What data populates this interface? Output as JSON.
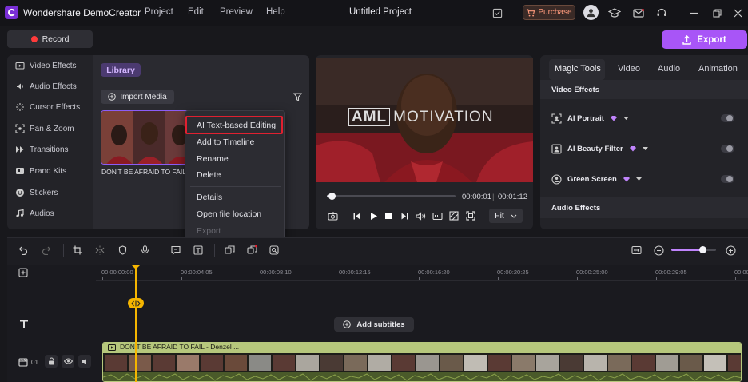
{
  "app": {
    "name": "Wondershare DemoCreator",
    "project_title": "Untitled Project"
  },
  "menu": [
    "Project",
    "Edit",
    "Preview",
    "Help"
  ],
  "titlebar": {
    "purchase_label": "Purchase"
  },
  "actions": {
    "record_label": "Record",
    "export_label": "Export"
  },
  "sidebar": {
    "items": [
      {
        "label": "Video Effects",
        "icon": "video-effects-icon"
      },
      {
        "label": "Audio Effects",
        "icon": "audio-effects-icon"
      },
      {
        "label": "Cursor Effects",
        "icon": "cursor-effects-icon"
      },
      {
        "label": "Pan & Zoom",
        "icon": "pan-zoom-icon"
      },
      {
        "label": "Transitions",
        "icon": "transitions-icon"
      },
      {
        "label": "Brand Kits",
        "icon": "brand-kits-icon"
      },
      {
        "label": "Stickers",
        "icon": "stickers-icon"
      },
      {
        "label": "Audios",
        "icon": "audios-icon"
      }
    ]
  },
  "library": {
    "tab_label": "Library",
    "import_label": "Import Media",
    "media": [
      {
        "name": "DON'T BE AFRAID TO FAIL - Denzel ..."
      }
    ]
  },
  "context_menu": {
    "items": [
      {
        "label": "AI Text-based Editing",
        "highlighted": true
      },
      {
        "label": "Add to Timeline"
      },
      {
        "label": "Rename"
      },
      {
        "label": "Delete"
      },
      {
        "label": "Details"
      },
      {
        "label": "Open file location"
      },
      {
        "label": "Export",
        "disabled": true
      }
    ]
  },
  "preview": {
    "watermark_bold": "AML",
    "watermark_light": "MOTIVATION",
    "current_time": "00:00:01",
    "total_time": "00:01:12",
    "progress": 0.02,
    "fit_label": "Fit"
  },
  "right_panel": {
    "tabs": [
      {
        "label": "Magic Tools",
        "active": true
      },
      {
        "label": "Video"
      },
      {
        "label": "Audio"
      },
      {
        "label": "Animation"
      }
    ],
    "video_effects_title": "Video Effects",
    "features": [
      {
        "label": "AI Portrait",
        "icon": "ai-portrait-icon",
        "enabled": false
      },
      {
        "label": "AI Beauty Filter",
        "icon": "ai-beauty-filter-icon",
        "enabled": false
      },
      {
        "label": "Green Screen",
        "icon": "green-screen-icon",
        "enabled": false
      }
    ],
    "audio_effects_title": "Audio Effects"
  },
  "timeline": {
    "ruler_labels": [
      "00:00:00:00",
      "00:00:04:05",
      "00:00:08:10",
      "00:00:12:15",
      "00:00:16:20",
      "00:00:20:25",
      "00:00:25:00",
      "00:00:29:05",
      "00:00:33:10"
    ],
    "add_subtitles_label": "Add subtitles",
    "track_number": "01",
    "clip_name": "DON'T BE AFRAID TO FAIL - Denzel ...",
    "zoom_level": 0.7
  },
  "colors": {
    "accent": "#a855f7",
    "highlight_box": "#e02030",
    "playhead": "#f5b500",
    "clip_border": "#b6c77c"
  }
}
